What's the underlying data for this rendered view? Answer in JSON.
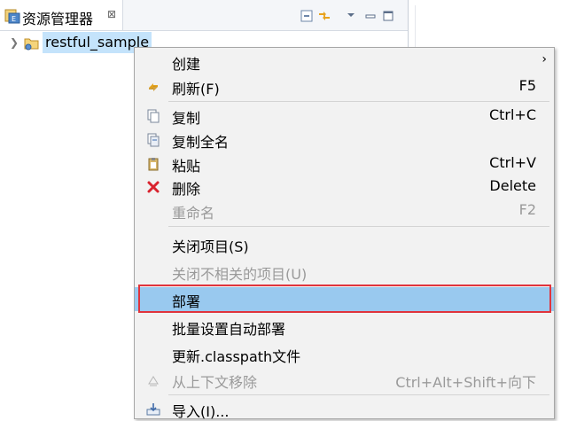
{
  "view": {
    "tab_title": "资源管理器",
    "tab_close": "⊠",
    "project_name": "restful_sample"
  },
  "context_menu": {
    "items": [
      {
        "label": "创建",
        "accelerator": "",
        "submenu_arrow": "›",
        "enabled": true
      },
      {
        "label": "刷新(F)",
        "accelerator": "F5",
        "enabled": true
      },
      {
        "label": "复制",
        "accelerator": "Ctrl+C",
        "enabled": true
      },
      {
        "label": "复制全名",
        "accelerator": "",
        "enabled": true
      },
      {
        "label": "粘贴",
        "accelerator": "Ctrl+V",
        "enabled": true
      },
      {
        "label": "删除",
        "accelerator": "Delete",
        "enabled": true
      },
      {
        "label": "重命名",
        "accelerator": "F2",
        "enabled": false
      },
      {
        "label": "关闭项目(S)",
        "accelerator": "",
        "enabled": true
      },
      {
        "label": "关闭不相关的项目(U)",
        "accelerator": "",
        "enabled": false
      },
      {
        "label": "部署",
        "accelerator": "",
        "enabled": true,
        "highlighted": true
      },
      {
        "label": "批量设置自动部署",
        "accelerator": "",
        "enabled": true
      },
      {
        "label": "更新.classpath文件",
        "accelerator": "",
        "enabled": true
      },
      {
        "label": "从上下文移除",
        "accelerator": "Ctrl+Alt+Shift+向下",
        "enabled": false
      },
      {
        "label": "导入(I)...",
        "accelerator": "",
        "enabled": true
      }
    ]
  },
  "colors": {
    "selection": "#c4e3fb",
    "menu_highlight": "#99c9ef",
    "annotation_frame": "#e0343d",
    "delete_icon": "#d9232e"
  },
  "icons": {
    "tab": "resource-explorer-icon",
    "collapse_all": "collapse-all-icon",
    "link_editor": "link-with-editor-icon",
    "view_menu": "view-menu-icon",
    "minimize": "minimize-icon",
    "maximize": "maximize-icon"
  }
}
